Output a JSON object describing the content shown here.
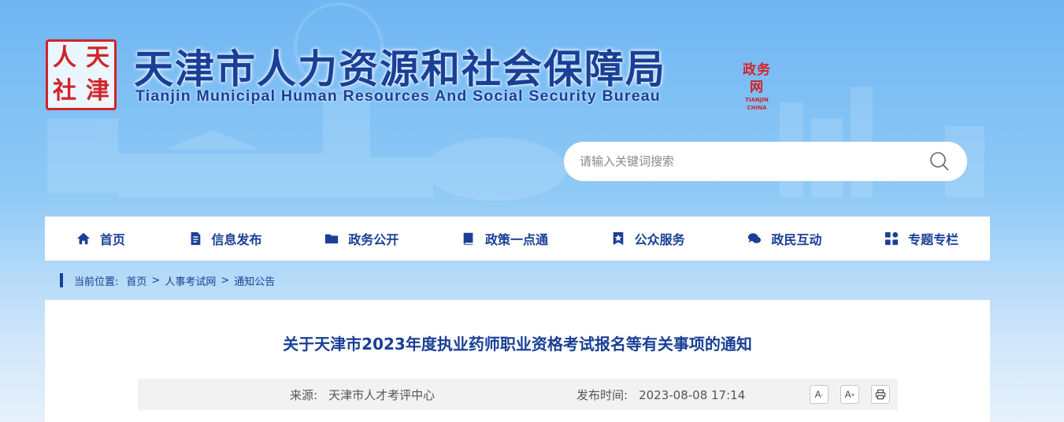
{
  "header": {
    "seal_chars": [
      "人",
      "天",
      "社",
      "津"
    ],
    "title": "天津市人力资源和社会保障局",
    "subtitle": "Tianjin Municipal Human Resources And Social Security Bureau",
    "mini_logo_text": "政务网",
    "mini_logo_sub": "TIANJIN CHINA"
  },
  "search": {
    "placeholder": "请输入关键词搜索"
  },
  "nav": {
    "items": [
      {
        "label": "首页",
        "icon": "home-icon"
      },
      {
        "label": "信息发布",
        "icon": "document-icon"
      },
      {
        "label": "政务公开",
        "icon": "folder-icon"
      },
      {
        "label": "政策一点通",
        "icon": "book-icon"
      },
      {
        "label": "公众服务",
        "icon": "star-bookmark-icon"
      },
      {
        "label": "政民互动",
        "icon": "chat-icon"
      },
      {
        "label": "专题专栏",
        "icon": "grid-icon"
      }
    ]
  },
  "breadcrumb": {
    "prefix": "当前位置:",
    "items": [
      "首页",
      "人事考试网",
      "通知公告"
    ],
    "separator": ">"
  },
  "article": {
    "title": "关于天津市2023年度执业药师职业资格考试报名等有关事项的通知",
    "source_label": "来源:",
    "source_value": "天津市人才考评中心",
    "time_label": "发布时间:",
    "time_value": "2023-08-08 17:14",
    "tools": {
      "decrease": "A-",
      "increase": "A+",
      "print": "print-icon"
    }
  },
  "colors": {
    "brand": "#1a3f96",
    "seal": "#d2232a",
    "bg_top": "#6fb6f2"
  }
}
